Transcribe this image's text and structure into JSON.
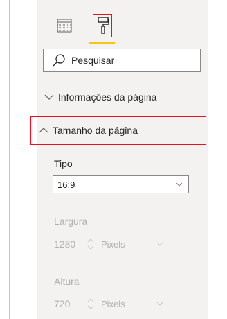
{
  "search": {
    "placeholder": "Pesquisar"
  },
  "sections": {
    "page_info": {
      "label": "Informações da página",
      "expanded": false
    },
    "page_size": {
      "label": "Tamanho da página",
      "expanded": true
    }
  },
  "page_size": {
    "type_label": "Tipo",
    "type_value": "16:9",
    "width_label": "Largura",
    "width_value": "1280",
    "width_unit": "Pixels",
    "height_label": "Altura",
    "height_value": "720",
    "height_unit": "Pixels"
  },
  "colors": {
    "highlight": "#e81123",
    "active_underline": "#f2c811",
    "pane_bg": "#f3f2f1",
    "disabled_text": "#b3b0ad"
  },
  "icons": {
    "fields": "fields-grid-icon",
    "format": "paint-roller-icon",
    "search": "search-icon",
    "collapsed": "chevron-down-icon",
    "expanded": "chevron-up-icon"
  }
}
